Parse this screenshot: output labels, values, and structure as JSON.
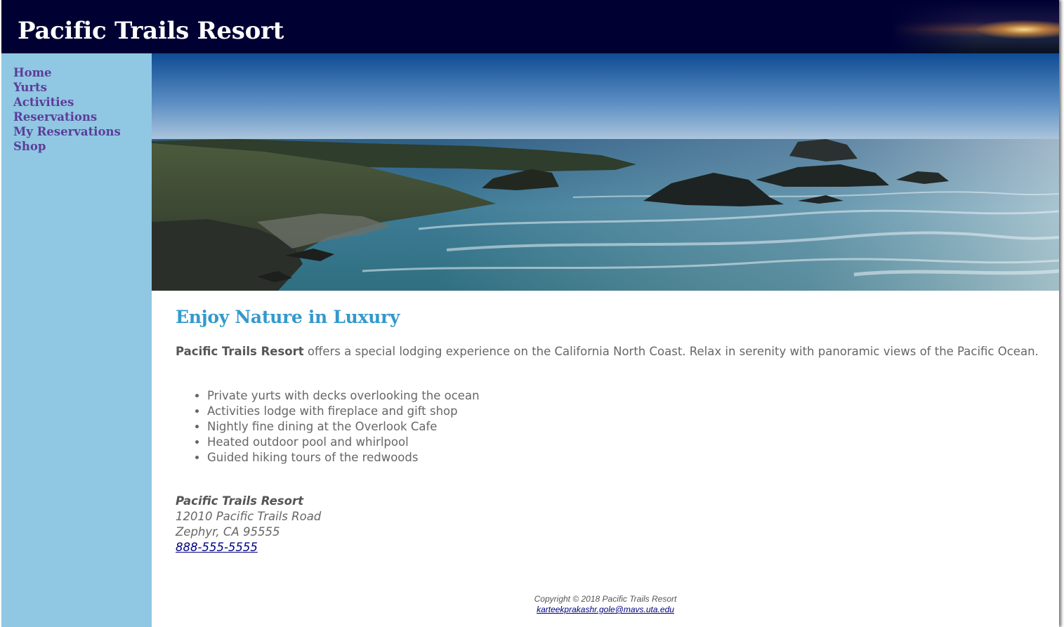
{
  "header": {
    "title": "Pacific Trails Resort"
  },
  "nav": {
    "items": [
      {
        "label": "Home"
      },
      {
        "label": "Yurts"
      },
      {
        "label": "Activities"
      },
      {
        "label": "Reservations"
      },
      {
        "label": "My Reservations"
      },
      {
        "label": "Shop"
      }
    ]
  },
  "main": {
    "hero_image": "coastline-photo",
    "headline": "Enjoy Nature in Luxury",
    "intro": {
      "name": "Pacific Trails Resort",
      "text": " offers a special lodging experience on the California North Coast. Relax in serenity with panoramic views of the Pacific Ocean."
    },
    "features": [
      "Private yurts with decks overlooking the ocean",
      "Activities lodge with fireplace and gift shop",
      "Nightly fine dining at the Overlook Cafe",
      "Heated outdoor pool and whirlpool",
      "Guided hiking tours of the redwoods"
    ],
    "contact": {
      "name": "Pacific Trails Resort",
      "street": "12010 Pacific Trails Road",
      "city": "Zephyr, CA 95555",
      "phone": "888-555-5555"
    }
  },
  "footer": {
    "copyright": "Copyright © 2018 Pacific Trails Resort",
    "email": "karteekprakashr.gole@mavs.uta.edu"
  },
  "colors": {
    "header_bg": "#000033",
    "nav_bg": "#90c7e3",
    "nav_link": "#5c3d99",
    "headline": "#3399cc",
    "body_text": "#666666",
    "link": "#000080"
  }
}
